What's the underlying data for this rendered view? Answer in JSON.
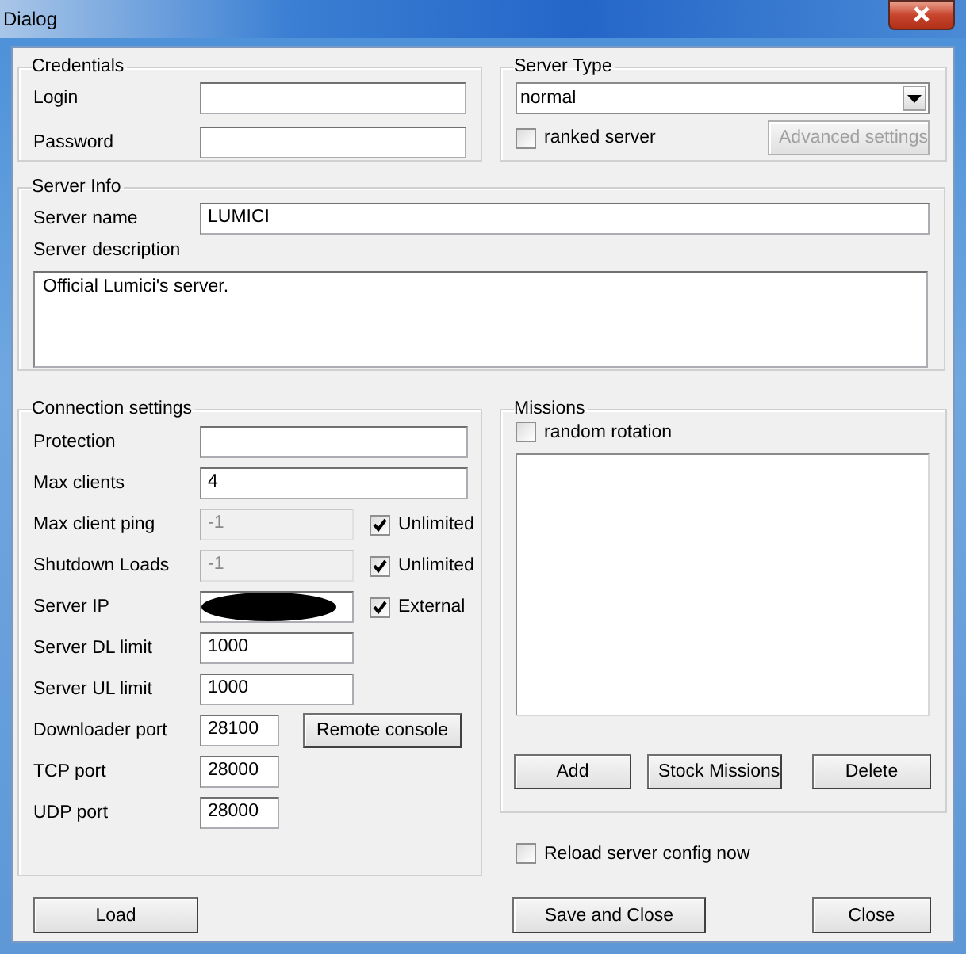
{
  "window": {
    "title": "Dialog"
  },
  "credentials": {
    "title": "Credentials",
    "fields": [
      {
        "label": "Login"
      },
      {
        "label": "Password"
      }
    ]
  },
  "server_type": {
    "title": "Server Type",
    "dropdown": {
      "value": "normal"
    },
    "ranked": {
      "label": "ranked server",
      "checked": false
    },
    "advanced_button": {
      "label": "Advanced settings",
      "disabled": true
    }
  },
  "server_info": {
    "title": "Server Info",
    "name": {
      "label": "Server name",
      "value": "LUMICI"
    },
    "description": {
      "label": "Server description",
      "value": "Official Lumici's server."
    }
  },
  "connection": {
    "title": "Connection settings",
    "rows": [
      {
        "label": "Protection",
        "kind": "wide",
        "disabled": false,
        "redacted": false
      },
      {
        "label": "Max clients",
        "value": "4",
        "kind": "wide",
        "disabled": false,
        "redacted": false
      },
      {
        "label": "Max client ping",
        "value": "-1",
        "kind": "medium",
        "disabled": true,
        "redacted": false,
        "option": {
          "label": "Unlimited",
          "checked": true
        }
      },
      {
        "label": "Shutdown Loads",
        "value": "-1",
        "kind": "medium",
        "disabled": true,
        "redacted": false,
        "option": {
          "label": "Unlimited",
          "checked": true
        }
      },
      {
        "label": "Server IP",
        "kind": "medium",
        "disabled": false,
        "redacted": true,
        "option": {
          "label": "External",
          "checked": true
        }
      },
      {
        "label": "Server DL limit",
        "value": "1000",
        "kind": "medium",
        "disabled": false,
        "redacted": false
      },
      {
        "label": "Server UL limit",
        "value": "1000",
        "kind": "medium",
        "disabled": false,
        "redacted": false
      },
      {
        "label": "Downloader port",
        "value": "28100",
        "kind": "port",
        "disabled": false,
        "redacted": false,
        "button": {
          "label": "Remote console"
        }
      },
      {
        "label": "TCP port",
        "value": "28000",
        "kind": "port",
        "disabled": false,
        "redacted": false
      },
      {
        "label": "UDP port",
        "value": "28000",
        "kind": "port",
        "disabled": false,
        "redacted": false
      }
    ]
  },
  "missions": {
    "title": "Missions",
    "random_rotation": {
      "label": "random rotation",
      "checked": false
    },
    "buttons": [
      {
        "label": "Add"
      },
      {
        "label": "Stock Missions"
      },
      {
        "label": "Delete"
      }
    ]
  },
  "reload": {
    "label": "Reload server config now",
    "checked": false
  },
  "footer_buttons": [
    {
      "label": "Load",
      "kind": "left"
    },
    {
      "label": "Save and Close",
      "kind": "center"
    },
    {
      "label": "Close",
      "kind": "right"
    }
  ]
}
